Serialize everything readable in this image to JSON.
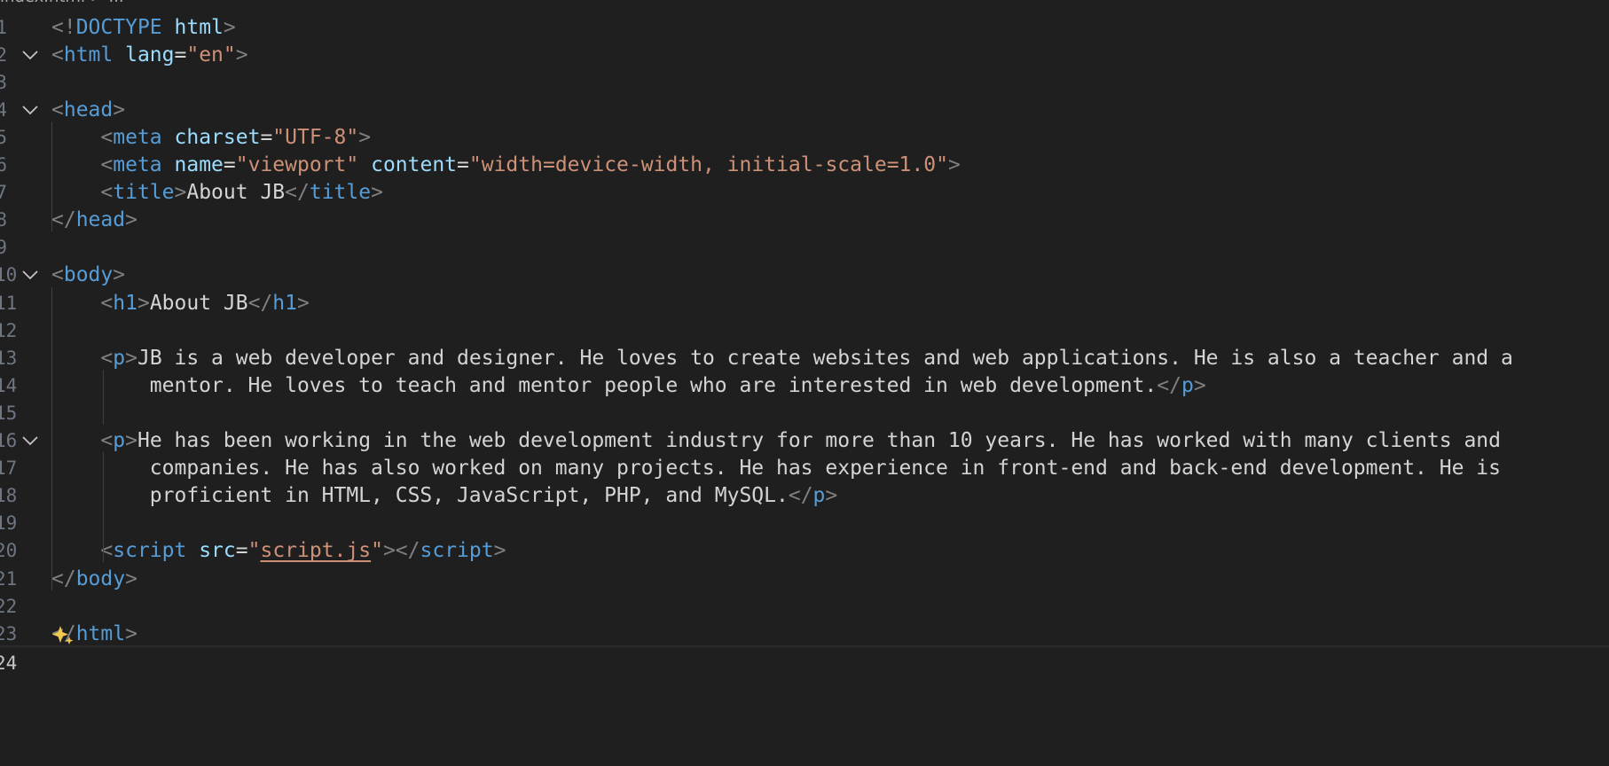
{
  "breadcrumb": "index.html > ...",
  "lines": [
    {
      "n": "1",
      "fold": false,
      "seg": [
        [
          "p",
          "<!"
        ],
        [
          "t",
          "DOCTYPE"
        ],
        [
          "x",
          " "
        ],
        [
          "a",
          "html"
        ],
        [
          "p",
          ">"
        ]
      ]
    },
    {
      "n": "2",
      "fold": true,
      "seg": [
        [
          "p",
          "<"
        ],
        [
          "t",
          "html"
        ],
        [
          "x",
          " "
        ],
        [
          "a",
          "lang"
        ],
        [
          "x",
          "="
        ],
        [
          "s",
          "\"en\""
        ],
        [
          "p",
          ">"
        ]
      ]
    },
    {
      "n": "3",
      "fold": false,
      "seg": []
    },
    {
      "n": "4",
      "fold": true,
      "seg": [
        [
          "p",
          "<"
        ],
        [
          "t",
          "head"
        ],
        [
          "p",
          ">"
        ]
      ]
    },
    {
      "n": "5",
      "fold": false,
      "seg": [
        [
          "x",
          "    "
        ],
        [
          "p",
          "<"
        ],
        [
          "t",
          "meta"
        ],
        [
          "x",
          " "
        ],
        [
          "a",
          "charset"
        ],
        [
          "x",
          "="
        ],
        [
          "s",
          "\"UTF-8\""
        ],
        [
          "p",
          ">"
        ]
      ]
    },
    {
      "n": "6",
      "fold": false,
      "seg": [
        [
          "x",
          "    "
        ],
        [
          "p",
          "<"
        ],
        [
          "t",
          "meta"
        ],
        [
          "x",
          " "
        ],
        [
          "a",
          "name"
        ],
        [
          "x",
          "="
        ],
        [
          "s",
          "\"viewport\""
        ],
        [
          "x",
          " "
        ],
        [
          "a",
          "content"
        ],
        [
          "x",
          "="
        ],
        [
          "s",
          "\"width=device-width, initial-scale=1.0\""
        ],
        [
          "p",
          ">"
        ]
      ]
    },
    {
      "n": "7",
      "fold": false,
      "seg": [
        [
          "x",
          "    "
        ],
        [
          "p",
          "<"
        ],
        [
          "t",
          "title"
        ],
        [
          "p",
          ">"
        ],
        [
          "x",
          "About JB"
        ],
        [
          "p",
          "</"
        ],
        [
          "t",
          "title"
        ],
        [
          "p",
          ">"
        ]
      ]
    },
    {
      "n": "8",
      "fold": false,
      "seg": [
        [
          "p",
          "</"
        ],
        [
          "t",
          "head"
        ],
        [
          "p",
          ">"
        ]
      ]
    },
    {
      "n": "9",
      "fold": false,
      "seg": []
    },
    {
      "n": "10",
      "fold": true,
      "seg": [
        [
          "p",
          "<"
        ],
        [
          "t",
          "body"
        ],
        [
          "p",
          ">"
        ]
      ]
    },
    {
      "n": "11",
      "fold": false,
      "seg": [
        [
          "x",
          "    "
        ],
        [
          "p",
          "<"
        ],
        [
          "t",
          "h1"
        ],
        [
          "p",
          ">"
        ],
        [
          "x",
          "About JB"
        ],
        [
          "p",
          "</"
        ],
        [
          "t",
          "h1"
        ],
        [
          "p",
          ">"
        ]
      ]
    },
    {
      "n": "12",
      "fold": false,
      "seg": []
    },
    {
      "n": "13",
      "fold": false,
      "seg": [
        [
          "x",
          "    "
        ],
        [
          "p",
          "<"
        ],
        [
          "t",
          "p"
        ],
        [
          "p",
          ">"
        ],
        [
          "x",
          "JB is a web developer and designer. He loves to create websites and web applications. He is also a teacher and a"
        ]
      ]
    },
    {
      "n": "14",
      "fold": false,
      "seg": [
        [
          "x",
          "        mentor. He loves to teach and mentor people who are interested in web development."
        ],
        [
          "p",
          "</"
        ],
        [
          "t",
          "p"
        ],
        [
          "p",
          ">"
        ]
      ]
    },
    {
      "n": "15",
      "fold": false,
      "seg": []
    },
    {
      "n": "16",
      "fold": true,
      "seg": [
        [
          "x",
          "    "
        ],
        [
          "p",
          "<"
        ],
        [
          "t",
          "p"
        ],
        [
          "p",
          ">"
        ],
        [
          "x",
          "He has been working in the web development industry for more than 10 years. He has worked with many clients and"
        ]
      ]
    },
    {
      "n": "17",
      "fold": false,
      "seg": [
        [
          "x",
          "        companies. He has also worked on many projects. He has experience in front-end and back-end development. He is"
        ]
      ]
    },
    {
      "n": "18",
      "fold": false,
      "seg": [
        [
          "x",
          "        proficient in HTML, CSS, JavaScript, PHP, and MySQL."
        ],
        [
          "p",
          "</"
        ],
        [
          "t",
          "p"
        ],
        [
          "p",
          ">"
        ]
      ]
    },
    {
      "n": "19",
      "fold": false,
      "seg": []
    },
    {
      "n": "20",
      "fold": false,
      "seg": [
        [
          "x",
          "    "
        ],
        [
          "p",
          "<"
        ],
        [
          "t",
          "script"
        ],
        [
          "x",
          " "
        ],
        [
          "a",
          "src"
        ],
        [
          "x",
          "="
        ],
        [
          "s",
          "\""
        ],
        [
          "sl",
          "script.js"
        ],
        [
          "s",
          "\""
        ],
        [
          "p",
          "></"
        ],
        [
          "t",
          "script"
        ],
        [
          "p",
          ">"
        ]
      ]
    },
    {
      "n": "21",
      "fold": false,
      "seg": [
        [
          "p",
          "</"
        ],
        [
          "t",
          "body"
        ],
        [
          "p",
          ">"
        ]
      ]
    },
    {
      "n": "22",
      "fold": false,
      "seg": []
    },
    {
      "n": "23",
      "fold": false,
      "seg": [
        [
          "p",
          "</"
        ],
        [
          "t",
          "html"
        ],
        [
          "p",
          ">"
        ]
      ]
    },
    {
      "n": "24",
      "fold": false,
      "seg": []
    }
  ],
  "icons": {
    "fold": "chevron-down-icon",
    "sparkle": "sparkle-icon"
  },
  "colors": {
    "background": "#1f1f1f",
    "tag": "#569cd6",
    "attribute": "#9cdcfe",
    "string": "#ce9178",
    "punctuation": "#808080",
    "text": "#d4d4d4",
    "line_number": "#6e7681"
  }
}
